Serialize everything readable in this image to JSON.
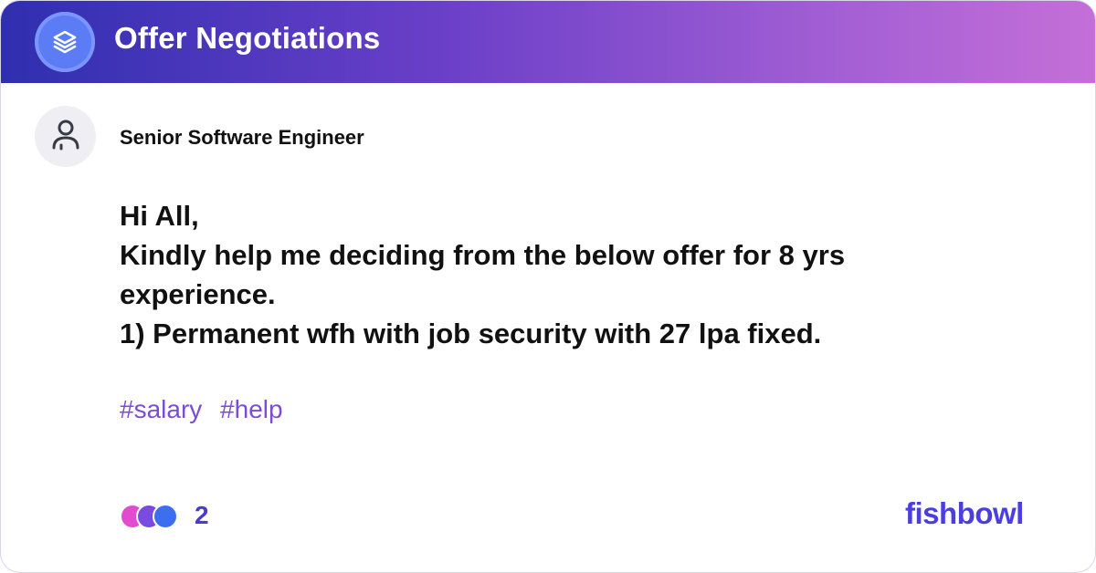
{
  "header": {
    "title": "Offer Negotiations",
    "icon": "layers-icon",
    "gradient": [
      "#2f2fb0",
      "#c56fd8"
    ]
  },
  "author": {
    "avatar_icon": "user-icon",
    "title": "Senior Software Engineer"
  },
  "post": {
    "lines": [
      "Hi All,",
      "Kindly help me deciding from the below offer for 8 yrs",
      "experience.",
      "1) Permanent wfh with job security with 27 lpa fixed."
    ]
  },
  "tags": [
    "#salary",
    "#help"
  ],
  "reactions": {
    "icons": [
      "heart-react-icon",
      "star-react-icon",
      "thumbs-react-icon"
    ],
    "colors": [
      "#e24bd0",
      "#7a4be0",
      "#3b6ff0"
    ],
    "count": "2"
  },
  "brand": {
    "name": "fishbowl",
    "color": "#4b3ee0"
  }
}
